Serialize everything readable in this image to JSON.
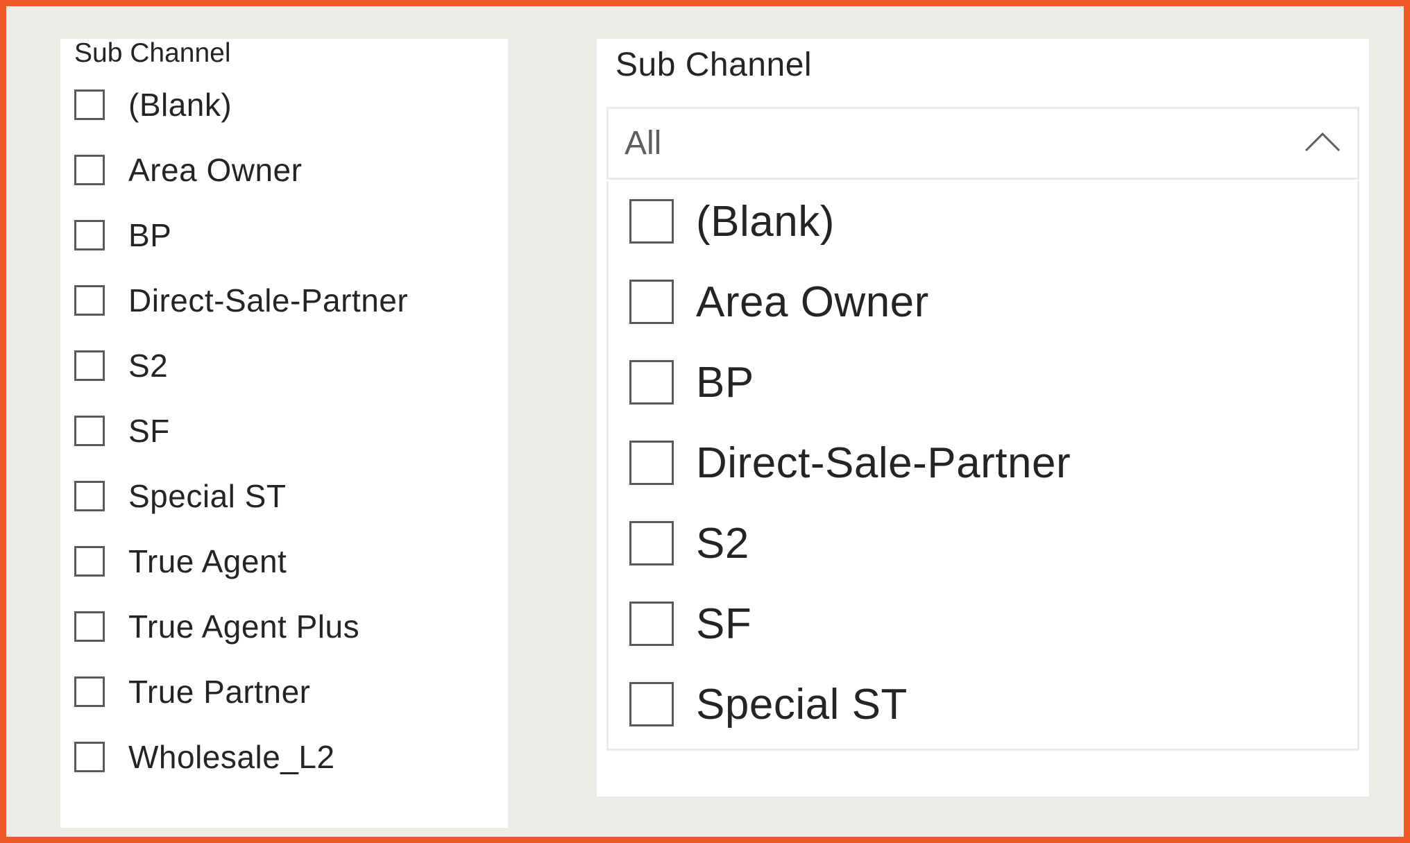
{
  "colors": {
    "frame_border": "#f05a2a",
    "canvas_background": "#edebe8",
    "panel_background": "#ffffff",
    "checkbox_border": "#5b5a59",
    "text": "#252423"
  },
  "list_slicer": {
    "header": "Sub Channel",
    "items": [
      {
        "label": "(Blank)",
        "checked": false
      },
      {
        "label": "Area Owner",
        "checked": false
      },
      {
        "label": "BP",
        "checked": false
      },
      {
        "label": "Direct-Sale-Partner",
        "checked": false
      },
      {
        "label": "S2",
        "checked": false
      },
      {
        "label": "SF",
        "checked": false
      },
      {
        "label": "Special ST",
        "checked": false
      },
      {
        "label": "True Agent",
        "checked": false
      },
      {
        "label": "True Agent Plus",
        "checked": false
      },
      {
        "label": "True Partner",
        "checked": false
      },
      {
        "label": "Wholesale_L2",
        "checked": false
      }
    ]
  },
  "dropdown_slicer": {
    "header": "Sub Channel",
    "selected_value": "All",
    "chevron_icon": "chevron-up-icon",
    "expanded": true,
    "items": [
      {
        "label": "(Blank)",
        "checked": false
      },
      {
        "label": "Area Owner",
        "checked": false
      },
      {
        "label": "BP",
        "checked": false
      },
      {
        "label": "Direct-Sale-Partner",
        "checked": false
      },
      {
        "label": "S2",
        "checked": false
      },
      {
        "label": "SF",
        "checked": false
      },
      {
        "label": "Special ST",
        "checked": false
      }
    ]
  }
}
